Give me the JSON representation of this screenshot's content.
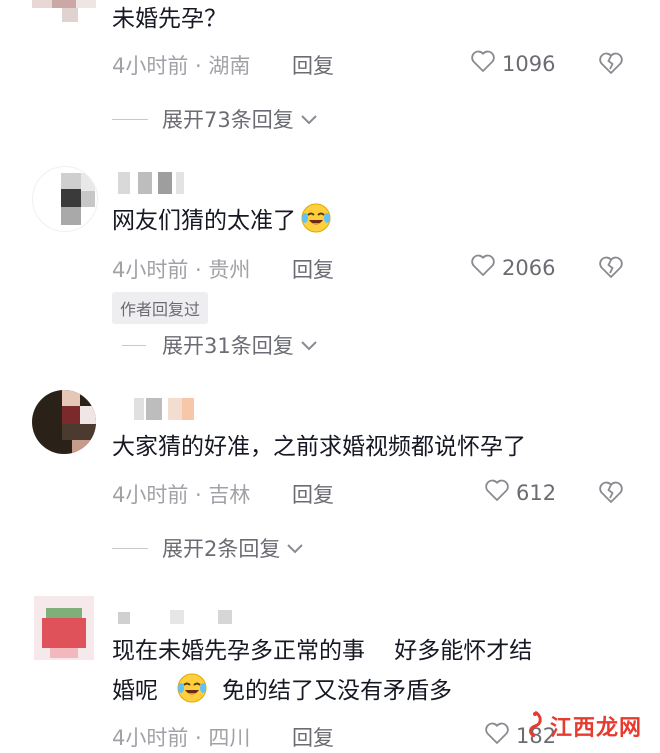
{
  "comments": [
    {
      "text": "未婚先孕？",
      "meta": "4小时前 · 湖南",
      "reply_label": "回复",
      "likes": "1096",
      "expand_label": "展开73条回复"
    },
    {
      "text": "网友们猜的太准了",
      "meta": "4小时前 · 贵州",
      "reply_label": "回复",
      "likes": "2066",
      "author_badge": "作者回复过",
      "expand_label": "展开31条回复"
    },
    {
      "text": "大家猜的好准，之前求婚视频都说怀孕了",
      "meta": "4小时前 · 吉林",
      "reply_label": "回复",
      "likes": "612",
      "expand_label": "展开2条回复"
    },
    {
      "text_line1": "现在未婚先孕多正常的事    好多能怀才结",
      "text_line2_a": "婚呢",
      "text_line2_b": "免的结了又没有矛盾多",
      "meta": "4小时前 · 四川",
      "reply_label": "回复",
      "likes": "182"
    }
  ],
  "watermark": {
    "text": "江西龙网"
  },
  "icons": {
    "like": "heart-outline-icon",
    "dislike": "broken-heart-icon",
    "expand": "chevron-down-icon",
    "emoji": "laughing-tears-emoji-icon"
  },
  "colors": {
    "text": "#161823",
    "meta": "#a1a2a7",
    "action": "#6b6c73",
    "watermark": "#e63b2e"
  }
}
